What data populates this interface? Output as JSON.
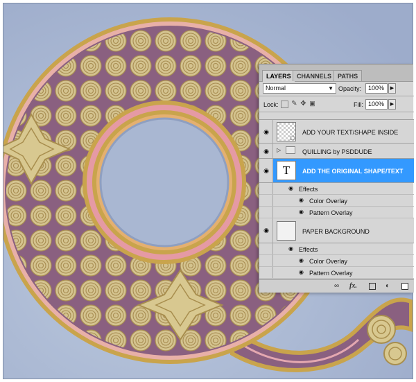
{
  "panel": {
    "tabs": [
      {
        "label": "LAYERS",
        "active": true
      },
      {
        "label": "CHANNELS",
        "active": false
      },
      {
        "label": "PATHS",
        "active": false
      }
    ],
    "blend_mode": "Normal",
    "opacity_label": "Opacity:",
    "opacity_value": "100%",
    "lock_label": "Lock:",
    "fill_label": "Fill:",
    "fill_value": "100%",
    "layers": [
      {
        "name": "ADD YOUR TEXT/SHAPE INSIDE",
        "visible": true,
        "thumb": "checker-smart"
      },
      {
        "name": "QUILLING by PSDDUDE",
        "visible": true,
        "thumb": "folder"
      },
      {
        "name": "ADD THE ORIGINAL SHAPE/TEXT",
        "visible": true,
        "thumb": "type",
        "selected": true,
        "thumb_glyph": "T"
      },
      {
        "name": "PAPER BACKGROUND",
        "visible": true,
        "thumb": "white"
      }
    ],
    "effects": [
      {
        "label": "Effects",
        "items": [
          "Color Overlay",
          "Pattern Overlay"
        ]
      },
      {
        "label": "Effects",
        "items": [
          "Color Overlay",
          "Pattern Overlay"
        ]
      }
    ],
    "bottom_icons": [
      "link-icon",
      "fx-icon",
      "mask-icon",
      "adjustment-icon",
      "new-layer-icon"
    ],
    "bottom_fx_label": "fx."
  },
  "colors": {
    "selected": "#3399ff",
    "panel_bg": "#d6d6d6",
    "canvas_bg": "#a7b5d0",
    "gold": "#c9a44c",
    "pink": "#d9899a",
    "purple": "#8a6080"
  }
}
